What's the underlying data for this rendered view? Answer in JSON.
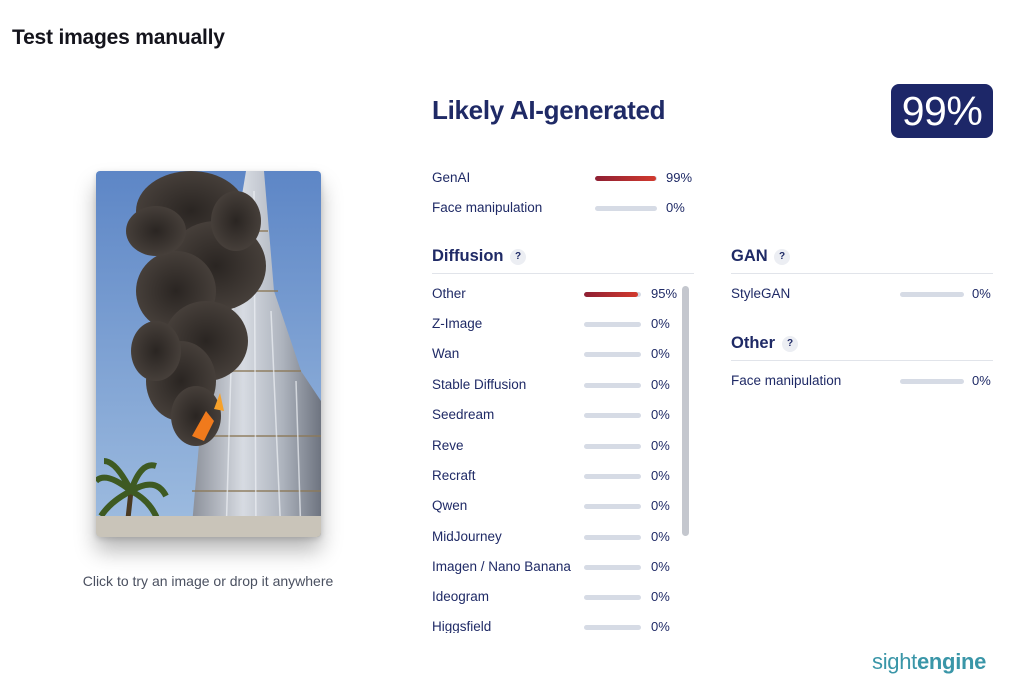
{
  "page": {
    "title": "Test images manually"
  },
  "upload": {
    "hint": "Click to try an image or drop it anywhere"
  },
  "verdict": {
    "title": "Likely AI-generated",
    "score": "99%"
  },
  "summary": [
    {
      "label": "GenAI",
      "percent": "99%",
      "value": 0.99
    },
    {
      "label": "Face manipulation",
      "percent": "0%",
      "value": 0
    }
  ],
  "diffusion": {
    "title": "Diffusion",
    "help": "?",
    "items": [
      {
        "label": "Other",
        "percent": "95%",
        "value": 0.95
      },
      {
        "label": "Z-Image",
        "percent": "0%",
        "value": 0
      },
      {
        "label": "Wan",
        "percent": "0%",
        "value": 0
      },
      {
        "label": "Stable Diffusion",
        "percent": "0%",
        "value": 0
      },
      {
        "label": "Seedream",
        "percent": "0%",
        "value": 0
      },
      {
        "label": "Reve",
        "percent": "0%",
        "value": 0
      },
      {
        "label": "Recraft",
        "percent": "0%",
        "value": 0
      },
      {
        "label": "Qwen",
        "percent": "0%",
        "value": 0
      },
      {
        "label": "MidJourney",
        "percent": "0%",
        "value": 0
      },
      {
        "label": "Imagen / Nano Banana",
        "percent": "0%",
        "value": 0
      },
      {
        "label": "Ideogram",
        "percent": "0%",
        "value": 0
      },
      {
        "label": "Higgsfield",
        "percent": "0%",
        "value": 0
      }
    ]
  },
  "gan": {
    "title": "GAN",
    "help": "?",
    "items": [
      {
        "label": "StyleGAN",
        "percent": "0%",
        "value": 0
      }
    ]
  },
  "other": {
    "title": "Other",
    "help": "?",
    "items": [
      {
        "label": "Face manipulation",
        "percent": "0%",
        "value": 0
      }
    ]
  },
  "brand": {
    "light": "sight",
    "bold": "engine",
    "color": "#3a96a8"
  },
  "colors": {
    "navy": "#1f2a66",
    "badge": "#1d2768",
    "bar_start": "#8e1f33",
    "bar_end": "#d23a2e",
    "track": "#d6dbe5"
  }
}
